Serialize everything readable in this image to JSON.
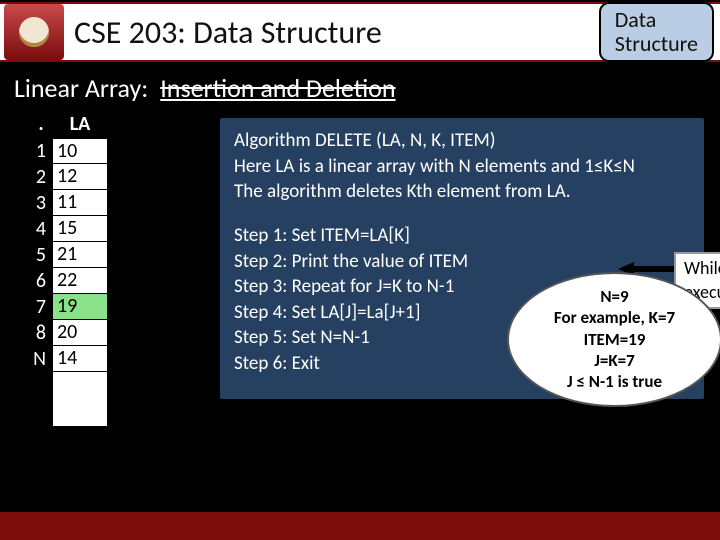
{
  "header": {
    "title": "CSE 203: Data Structure",
    "badge_line1": "Data",
    "badge_line2": "Structure"
  },
  "subhead": {
    "label": "Linear Array:",
    "topic": "Insertion and Deletion"
  },
  "array": {
    "col1_head": ".",
    "col2_head": "LA",
    "rows": [
      {
        "idx": "1",
        "val": "10",
        "hi": false
      },
      {
        "idx": "2",
        "val": "12",
        "hi": false
      },
      {
        "idx": "3",
        "val": "11",
        "hi": false
      },
      {
        "idx": "4",
        "val": "15",
        "hi": false
      },
      {
        "idx": "5",
        "val": "21",
        "hi": false
      },
      {
        "idx": "6",
        "val": "22",
        "hi": false
      },
      {
        "idx": "7",
        "val": "19",
        "hi": true
      },
      {
        "idx": "8",
        "val": "20",
        "hi": false
      },
      {
        "idx": "N",
        "val": "14",
        "hi": false
      }
    ]
  },
  "algorithm": {
    "intro": [
      "Algorithm DELETE (LA, N, K, ITEM)",
      "Here LA is a linear array with N elements and 1≤K≤N",
      "The algorithm deletes Kth element from LA."
    ],
    "steps": [
      "Step 1: Set ITEM=LA[K]",
      "Step 2: Print the value of ITEM",
      "Step 3: Repeat for J=K to N-1",
      "Step 4: Set LA[J]=La[J+1]",
      "Step 5: Set N=N-1",
      "Step 6: Exit"
    ],
    "while_note": "While executing",
    "example": [
      "N=9",
      "For example, K=7",
      "ITEM=19",
      "J=K=7",
      "J ≤ N-1 is true"
    ]
  }
}
